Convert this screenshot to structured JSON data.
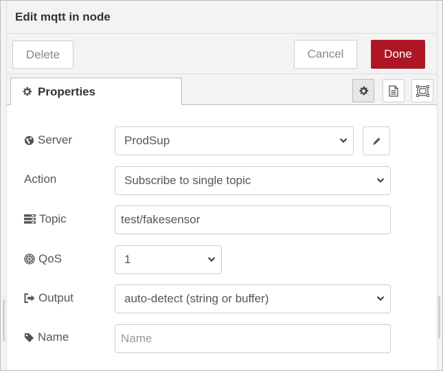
{
  "dialog": {
    "title": "Edit mqtt in node",
    "delete_label": "Delete",
    "cancel_label": "Cancel",
    "done_label": "Done",
    "accent_color": "#ad1625"
  },
  "tabs": {
    "properties_label": "Properties",
    "icons": [
      "gear-icon",
      "description-icon",
      "appearance-icon"
    ]
  },
  "form": {
    "server": {
      "label": "Server",
      "value": "ProdSup",
      "icon": "globe-icon"
    },
    "action": {
      "label": "Action",
      "value": "Subscribe to single topic"
    },
    "topic": {
      "label": "Topic",
      "value": "test/fakesensor",
      "icon": "tasks-icon"
    },
    "qos": {
      "label": "QoS",
      "value": "1",
      "icon": "empire-icon"
    },
    "output": {
      "label": "Output",
      "value": "auto-detect (string or buffer)",
      "icon": "sign-out-icon"
    },
    "name": {
      "label": "Name",
      "value": "",
      "placeholder": "Name",
      "icon": "tag-icon"
    }
  }
}
